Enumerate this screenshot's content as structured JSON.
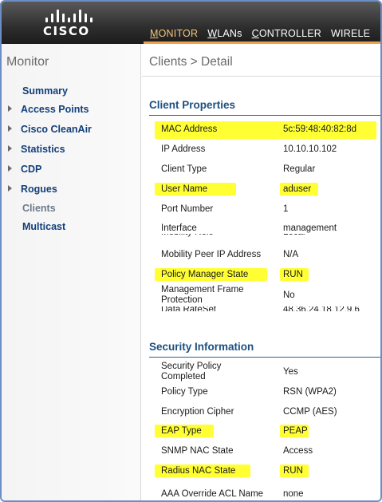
{
  "header": {
    "logo_text": "CISCO",
    "nav": [
      {
        "label": "MONITOR",
        "accel": "M",
        "active": true
      },
      {
        "label": "WLANs",
        "accel": "W",
        "active": false
      },
      {
        "label": "CONTROLLER",
        "accel": "C",
        "active": false
      },
      {
        "label": "WIRELE",
        "accel": "",
        "active": false
      }
    ]
  },
  "sidebar": {
    "title": "Monitor",
    "items": [
      {
        "label": "Summary",
        "expandable": false
      },
      {
        "label": "Access Points",
        "expandable": true
      },
      {
        "label": "Cisco CleanAir",
        "expandable": true
      },
      {
        "label": "Statistics",
        "expandable": true
      },
      {
        "label": "CDP",
        "expandable": true
      },
      {
        "label": "Rogues",
        "expandable": true
      },
      {
        "label": "Clients",
        "expandable": false,
        "active": true
      },
      {
        "label": "Multicast",
        "expandable": false
      }
    ]
  },
  "main": {
    "page_title": "Clients > Detail",
    "client_properties": {
      "title": "Client Properties",
      "rows": [
        {
          "label": "MAC Address",
          "value": "5c:59:48:40:82:8d",
          "highlighted": true
        },
        {
          "label": "IP Address",
          "value": "10.10.10.102",
          "highlighted": false
        },
        {
          "label": "Client Type",
          "value": "Regular",
          "highlighted": false
        },
        {
          "label": "User Name",
          "value": "aduser",
          "highlighted": true
        },
        {
          "label": "Port Number",
          "value": "1",
          "highlighted": false
        },
        {
          "label": "Interface",
          "value": "management",
          "highlighted": false
        },
        {
          "label": "Mobility Peer IP Address",
          "value": "N/A",
          "highlighted": false
        },
        {
          "label": "Policy Manager State",
          "value": "RUN",
          "highlighted": true
        },
        {
          "label": "Management Frame Protection",
          "value": "No",
          "highlighted": false
        }
      ]
    },
    "security_information": {
      "title": "Security Information",
      "rows": [
        {
          "label": "Security Policy Completed",
          "value": "Yes",
          "highlighted": false
        },
        {
          "label": "Policy Type",
          "value": "RSN (WPA2)",
          "highlighted": false
        },
        {
          "label": "Encryption Cipher",
          "value": "CCMP (AES)",
          "highlighted": false
        },
        {
          "label": "EAP Type",
          "value": "PEAP",
          "highlighted": true
        },
        {
          "label": "SNMP NAC State",
          "value": "Access",
          "highlighted": false
        },
        {
          "label": "Radius NAC State",
          "value": "RUN",
          "highlighted": true
        },
        {
          "label": "AAA Override ACL Name",
          "value": "none",
          "highlighted": false
        }
      ]
    }
  },
  "colors": {
    "highlight": "#ffff33",
    "link": "#123f7a",
    "section_title": "#1d4f80",
    "nav_active": "#f4c57a",
    "nav_bar": "#f0a14b"
  }
}
